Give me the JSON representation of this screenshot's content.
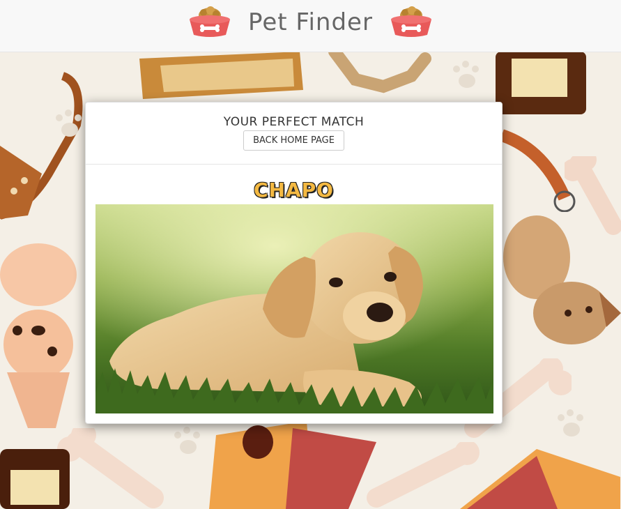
{
  "header": {
    "title": "Pet Finder",
    "icon_left": "pet-bowl-icon",
    "icon_right": "pet-bowl-icon"
  },
  "panel": {
    "title": "YOUR PERFECT MATCH",
    "back_button": "BACK HOME PAGE",
    "pet_name": "CHAPO",
    "photo": "puppy-lying-on-grass"
  },
  "colors": {
    "header_bg": "#f8f8f8",
    "bowl_red": "#e85a5a",
    "name_yellow": "#f4b942",
    "background": "#f4efe6"
  }
}
